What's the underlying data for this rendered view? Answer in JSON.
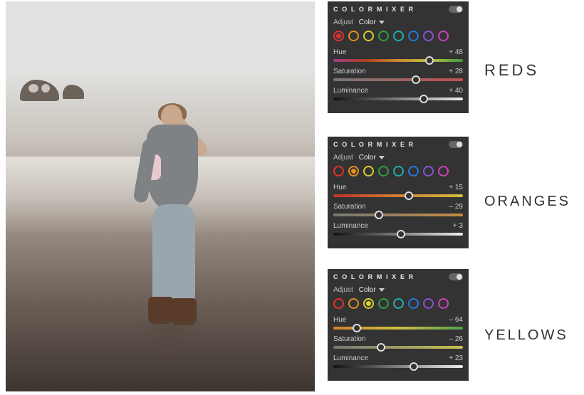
{
  "labels": {
    "reds": "REDS",
    "oranges": "ORANGES",
    "yellows": "YELLOWS"
  },
  "panels": [
    {
      "title": "C O L O R  M I X E R",
      "adjust_label": "Adjust",
      "adjust_value": "Color",
      "selected_color_index": 0,
      "swatches": [
        "#e13030",
        "#e88c20",
        "#d6d030",
        "#30a040",
        "#20b0a8",
        "#2878d8",
        "#8a50d8",
        "#d040c0"
      ],
      "sliders": {
        "hue": {
          "label": "Hue",
          "value": "+ 48",
          "pos": 74
        },
        "saturation": {
          "label": "Saturation",
          "value": "+ 28",
          "pos": 64
        },
        "luminance": {
          "label": "Luminance",
          "value": "+ 40",
          "pos": 70
        }
      }
    },
    {
      "title": "C O L O R  M I X E R",
      "adjust_label": "Adjust",
      "adjust_value": "Color",
      "selected_color_index": 1,
      "swatches": [
        "#e13030",
        "#e88c20",
        "#d6d030",
        "#30a040",
        "#20b0a8",
        "#2878d8",
        "#8a50d8",
        "#d040c0"
      ],
      "sliders": {
        "hue": {
          "label": "Hue",
          "value": "+ 15",
          "pos": 58
        },
        "saturation": {
          "label": "Saturation",
          "value": "– 29",
          "pos": 35
        },
        "luminance": {
          "label": "Luminance",
          "value": "+ 3",
          "pos": 52
        }
      }
    },
    {
      "title": "C O L O R  M I X E R",
      "adjust_label": "Adjust",
      "adjust_value": "Color",
      "selected_color_index": 2,
      "swatches": [
        "#e13030",
        "#e88c20",
        "#d6d030",
        "#30a040",
        "#20b0a8",
        "#2878d8",
        "#8a50d8",
        "#d040c0"
      ],
      "sliders": {
        "hue": {
          "label": "Hue",
          "value": "– 64",
          "pos": 18
        },
        "saturation": {
          "label": "Saturation",
          "value": "– 26",
          "pos": 37
        },
        "luminance": {
          "label": "Luminance",
          "value": "+ 23",
          "pos": 62
        }
      }
    }
  ]
}
